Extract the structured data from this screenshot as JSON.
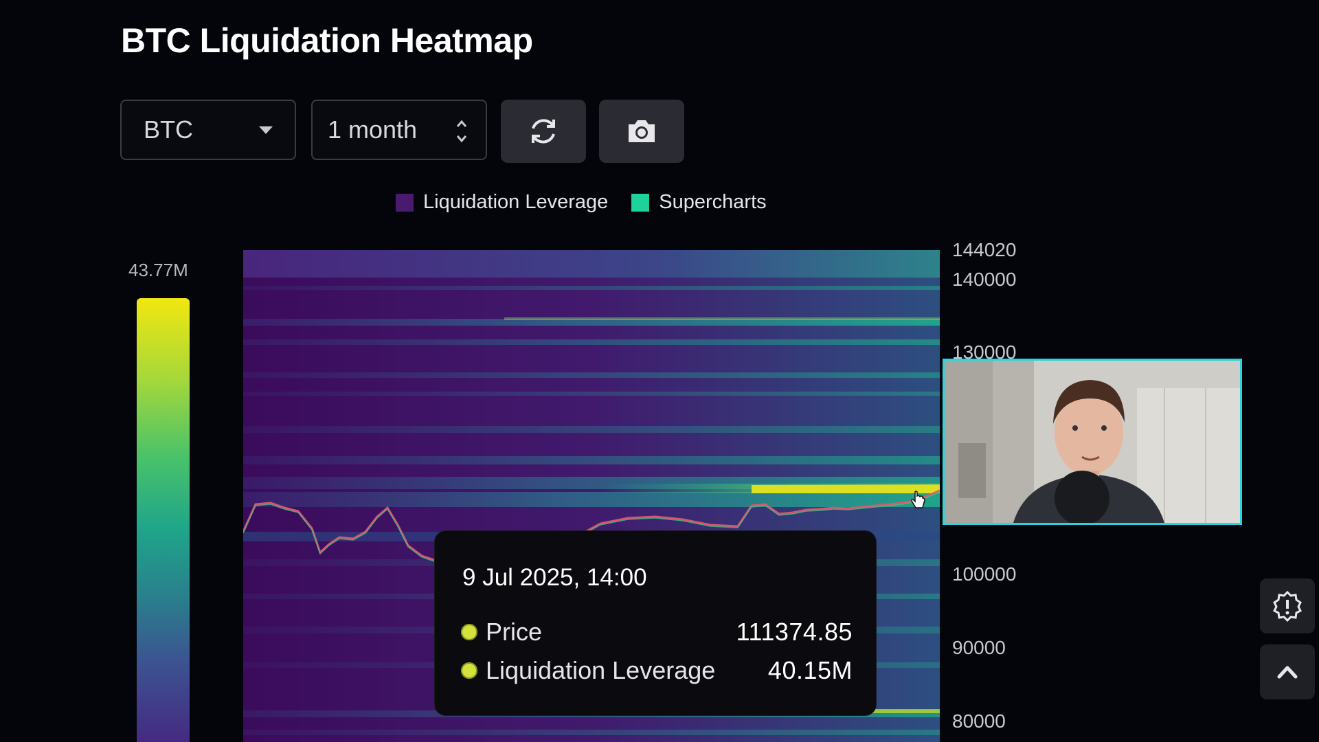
{
  "page": {
    "title": "BTC Liquidation Heatmap"
  },
  "toolbar": {
    "asset_select": {
      "value": "BTC"
    },
    "range_select": {
      "value": "1 month"
    },
    "refresh_button": {
      "icon": "refresh-icon"
    },
    "screenshot_button": {
      "icon": "camera-icon"
    }
  },
  "legend": {
    "items": [
      {
        "label": "Liquidation Leverage",
        "color": "#4a1a6e"
      },
      {
        "label": "Supercharts",
        "color": "#1ed39a"
      }
    ]
  },
  "colorbar": {
    "max_label": "43.77M"
  },
  "y_axis": {
    "labels": [
      "144020",
      "140000",
      "130000",
      "100000",
      "90000",
      "80000"
    ]
  },
  "tooltip": {
    "date": "9 Jul 2025, 14:00",
    "rows": [
      {
        "label": "Price",
        "value": "111374.85"
      },
      {
        "label": "Liquidation Leverage",
        "value": "40.15M"
      }
    ]
  },
  "colors": {
    "background": "#04050b",
    "heat_low": "#3b0b5c",
    "heat_mid": "#1f9a8e",
    "heat_high": "#f1e70f",
    "webcam_border": "#27d6e0"
  }
}
